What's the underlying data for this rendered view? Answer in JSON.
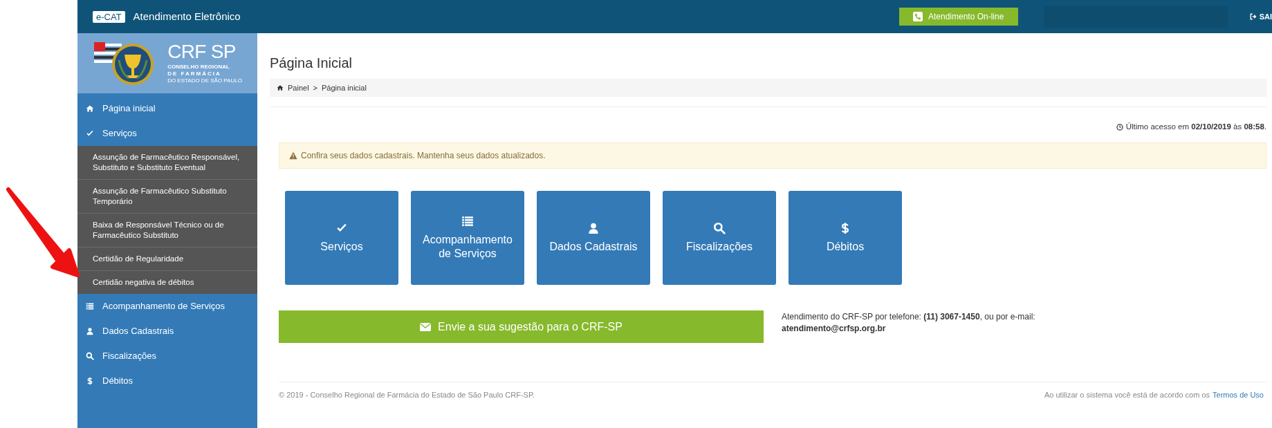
{
  "top_bar": {
    "badge": "e-CAT",
    "title": "Atendimento Eletrônico",
    "online_button": "Atendimento On-line",
    "logout": "SAI"
  },
  "sidebar": {
    "logo": {
      "title": "CRF SP",
      "subtitle_1": "CONSELHO REGIONAL",
      "subtitle_2": "DE FARMÁCIA",
      "subtitle_3": "DO ESTADO DE SÃO PAULO"
    },
    "items": [
      {
        "label": "Página inicial",
        "kind": "home"
      },
      {
        "label": "Serviços",
        "kind": "check",
        "expanded": true,
        "children": [
          {
            "label": "Assunção de Farmacêutico Responsável, Substituto e Substituto Eventual"
          },
          {
            "label": "Assunção de Farmacêutico Substituto Temporário"
          },
          {
            "label": "Baixa de Responsável Técnico ou de Farmacêutico Substituto"
          },
          {
            "label": "Certidão de Regularidade"
          },
          {
            "label": "Certidão negativa de débitos"
          }
        ]
      },
      {
        "label": "Acompanhamento de Serviços",
        "kind": "list"
      },
      {
        "label": "Dados Cadastrais",
        "kind": "user"
      },
      {
        "label": "Fiscalizações",
        "kind": "search"
      },
      {
        "label": "Débitos",
        "kind": "dollar"
      }
    ]
  },
  "page": {
    "title": "Página Inicial",
    "breadcrumb": [
      "Painel",
      ">",
      "Página inicial"
    ],
    "last_access": "Último acesso em **02/10/2019** às **08:58**.",
    "alert": "Confira seus dados cadastrais. Mantenha seus dados atualizados.",
    "tiles": [
      {
        "label": "Serviços",
        "kind": "check"
      },
      {
        "label": "Acompanhamento de Serviços",
        "kind": "list"
      },
      {
        "label": "Dados Cadastrais",
        "kind": "user"
      },
      {
        "label": "Fiscalizações",
        "kind": "search"
      },
      {
        "label": "Débitos",
        "kind": "dollar"
      }
    ],
    "suggestion_button": "Envie a sua sugestão para o CRF-SP",
    "contact": {
      "text": "Atendimento do CRF-SP por telefone: **(11) 3067-1450**, ou por e-mail:",
      "email": "atendimento@crfsp.org.br"
    }
  },
  "footer": {
    "copyright": "© 2019 - Conselho Regional de Farmácia do Estado de São Paulo CRF-SP.",
    "terms_text": "Ao utilizar o sistema você está de acordo com os",
    "terms_link": "Termos de Uso"
  }
}
